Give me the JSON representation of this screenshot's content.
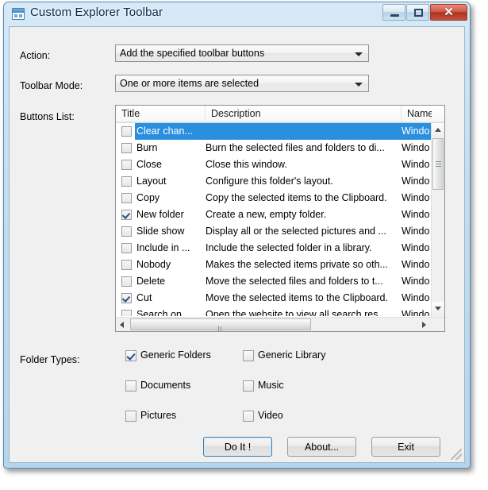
{
  "window": {
    "title": "Custom Explorer Toolbar",
    "icon": "explorer-window-icon",
    "caption": {
      "minimize": "minimize-icon",
      "maximize": "maximize-icon",
      "close": "✕"
    }
  },
  "fields": {
    "action_label": "Action:",
    "action_value": "Add the specified toolbar buttons",
    "toolbar_mode_label": "Toolbar Mode:",
    "toolbar_mode_value": "One or more items are selected",
    "buttons_list_label": "Buttons List:",
    "folder_types_label": "Folder Types:"
  },
  "list": {
    "columns": [
      "Title",
      "Description",
      "Name"
    ],
    "rows": [
      {
        "checked": false,
        "selected": true,
        "title": "Clear chan...",
        "description": "",
        "name": "Windo"
      },
      {
        "checked": false,
        "selected": false,
        "title": "Burn",
        "description": "Burn the selected files and folders to di...",
        "name": "Windo"
      },
      {
        "checked": false,
        "selected": false,
        "title": "Close",
        "description": "Close this window.",
        "name": "Windo"
      },
      {
        "checked": false,
        "selected": false,
        "title": "Layout",
        "description": "Configure this folder's layout.",
        "name": "Windo"
      },
      {
        "checked": false,
        "selected": false,
        "title": "Copy",
        "description": "Copy the selected items to the Clipboard.",
        "name": "Windo"
      },
      {
        "checked": true,
        "selected": false,
        "title": "New folder",
        "description": "Create a new, empty folder.",
        "name": "Windo"
      },
      {
        "checked": false,
        "selected": false,
        "title": "Slide show",
        "description": "Display all or the selected pictures and ...",
        "name": "Windo"
      },
      {
        "checked": false,
        "selected": false,
        "title": "Include in ...",
        "description": "Include the selected folder in a library.",
        "name": "Windo"
      },
      {
        "checked": false,
        "selected": false,
        "title": "Nobody",
        "description": "Makes the selected items private so oth...",
        "name": "Windo"
      },
      {
        "checked": false,
        "selected": false,
        "title": "Delete",
        "description": "Move the selected files and folders to t...",
        "name": "Windo"
      },
      {
        "checked": true,
        "selected": false,
        "title": "Cut",
        "description": "Move the selected items to the Clipboard.",
        "name": "Windo"
      },
      {
        "checked": false,
        "selected": false,
        "title": "Search on...",
        "description": "Open the website to view all search res...",
        "name": "Windo"
      }
    ]
  },
  "folder_types": [
    {
      "label": "Generic Folders",
      "checked": true
    },
    {
      "label": "Generic Library",
      "checked": false
    },
    {
      "label": "Documents",
      "checked": false
    },
    {
      "label": "Music",
      "checked": false
    },
    {
      "label": "Pictures",
      "checked": false
    },
    {
      "label": "Video",
      "checked": false
    }
  ],
  "buttons": {
    "do_it": "Do It !",
    "about": "About...",
    "exit": "Exit"
  },
  "colors": {
    "selection": "#2b8fe0",
    "frame": "#b6d5ec",
    "close_button": "#ad3320",
    "default_button_border": "#3c7fb1"
  }
}
